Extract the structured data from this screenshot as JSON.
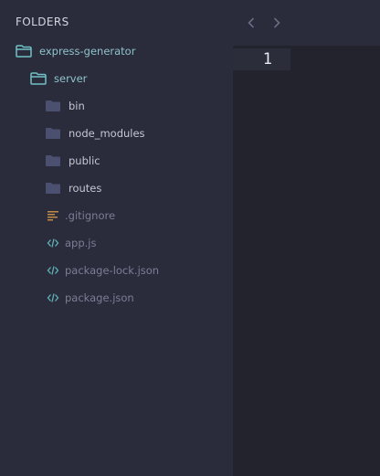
{
  "sidebar": {
    "header": "FOLDERS",
    "tree": {
      "root": {
        "label": "express-generator",
        "icon": "folder-open-icon"
      },
      "server": {
        "label": "server",
        "icon": "folder-open-icon"
      },
      "folders": [
        {
          "label": "bin",
          "icon": "folder-icon"
        },
        {
          "label": "node_modules",
          "icon": "folder-icon"
        },
        {
          "label": "public",
          "icon": "folder-icon"
        },
        {
          "label": "routes",
          "icon": "folder-icon"
        }
      ],
      "files": [
        {
          "label": ".gitignore",
          "icon": "text-file-icon"
        },
        {
          "label": "app.js",
          "icon": "code-file-icon"
        },
        {
          "label": "package-lock.json",
          "icon": "code-file-icon"
        },
        {
          "label": "package.json",
          "icon": "code-file-icon"
        }
      ]
    }
  },
  "editor": {
    "line_numbers": [
      "1"
    ],
    "nav": {
      "back_icon": "chevron-left-icon",
      "forward_icon": "chevron-right-icon"
    }
  },
  "colors": {
    "sidebar_bg": "#2a2b3b",
    "editor_bg": "#23232e",
    "open_folder": "#6fc3c8",
    "closed_folder": "#4c5070",
    "code_icon": "#5fb3b8",
    "text_icon": "#c08a4a"
  }
}
